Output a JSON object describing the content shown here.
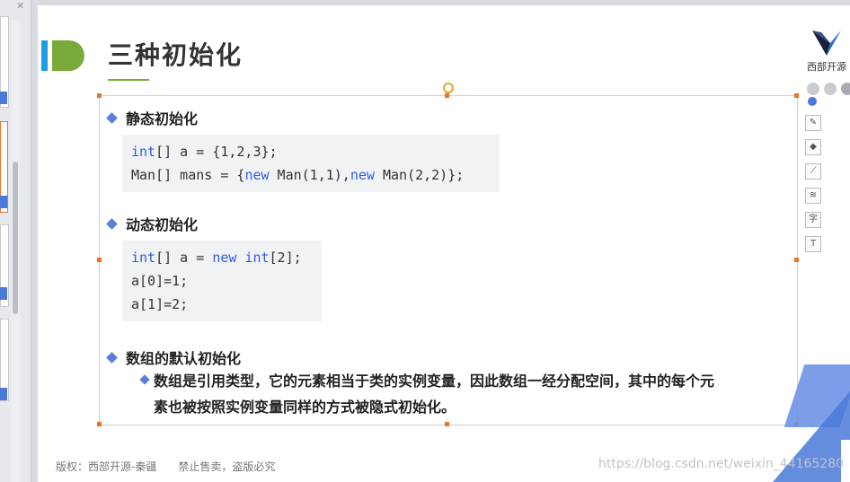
{
  "slide": {
    "title": "三种初始化",
    "logo_text": "西部开源",
    "sections": [
      {
        "label": "静态初始化"
      },
      {
        "label": "动态初始化"
      },
      {
        "label": "数组的默认初始化"
      }
    ],
    "code_static": {
      "line1": [
        "int",
        "[] a = {1,2,3};"
      ],
      "line2_pre": "Man[] mans = {",
      "line2_kw1": "new",
      "line2_mid": " Man(1,1),",
      "line2_kw2": "new",
      "line2_post": " Man(2,2)};"
    },
    "code_dynamic": {
      "line1_kw1": "int",
      "line1_mid": "[] a = ",
      "line1_kw2": "new",
      "line1_sp": " ",
      "line1_kw3": "int",
      "line1_post": "[2];",
      "line2": "a[0]=1;",
      "line3": "a[1]=2;"
    },
    "paragraph_line1": "数组是引用类型，它的元素相当于类的实例变量，因此数组一经分配空间，其中的每个元",
    "paragraph_line2": "素也被按照实例变量同样的方式被隐式初始化。",
    "footer": "版权：西部开源-秦疆　　禁止售卖，盗版必究",
    "watermark": "https://blog.csdn.net/weixin_44165280"
  },
  "tools": [
    "edit-icon",
    "fill-icon",
    "line-icon",
    "layers-icon",
    "text-icon",
    "text-format-icon"
  ],
  "colors": {
    "accent_blue": "#4a79d8",
    "title_green": "#7aaa3a",
    "keyword": "#2f5ee0"
  }
}
